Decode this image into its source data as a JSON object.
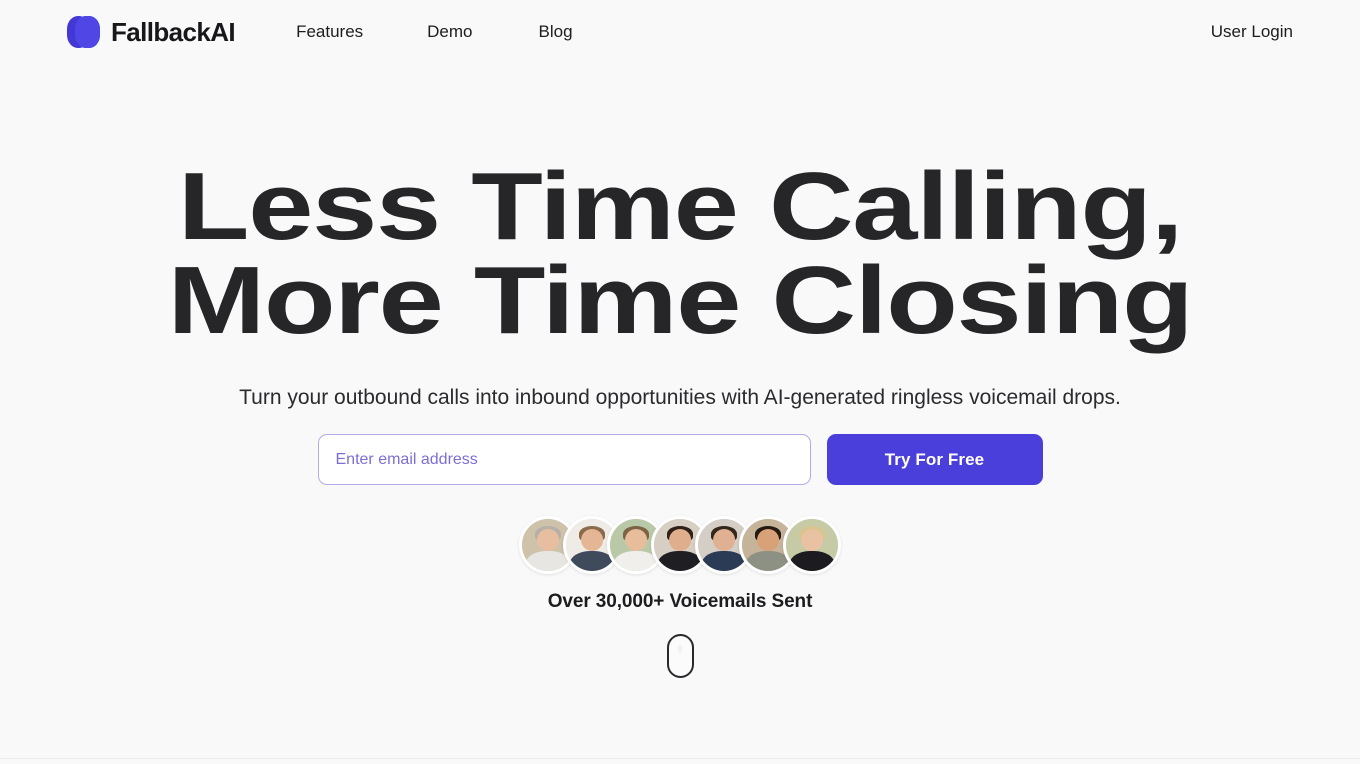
{
  "brand": {
    "name": "FallbackAI",
    "logo_icon": "fallbackai-layered-pill-logo",
    "colors": {
      "primary": "#4f46e5",
      "primary_dark": "#4338d6"
    }
  },
  "header": {
    "nav": [
      {
        "label": "Features",
        "name": "nav-features"
      },
      {
        "label": "Demo",
        "name": "nav-demo"
      },
      {
        "label": "Blog",
        "name": "nav-blog"
      }
    ],
    "login_label": "User Login"
  },
  "hero": {
    "headline_line_1": "Less Time Calling,",
    "headline_line_2": "More Time Closing",
    "subtitle": "Turn your outbound calls into inbound opportunities with AI-generated ringless voicemail drops.",
    "signup": {
      "email_value": "",
      "email_placeholder": "Enter email address",
      "cta_label": "Try For Free",
      "cta_color": "#4b3fdb",
      "input_border_color": "#b3abe8"
    },
    "social_proof": "Over 30,000+ Voicemails Sent",
    "avatars": [
      {
        "name": "avatar-person-1",
        "skin": "#e7bfa0",
        "hair": "#b8b0a6",
        "clothes": "#e8e6e2",
        "bg": "#cfc2ab"
      },
      {
        "name": "avatar-person-2",
        "skin": "#e4b695",
        "hair": "#8a6a4a",
        "clothes": "#3f4a5c",
        "bg": "#efece7"
      },
      {
        "name": "avatar-person-3",
        "skin": "#e8bd9b",
        "hair": "#7e6246",
        "clothes": "#f1efeb",
        "bg": "#b9c9a8"
      },
      {
        "name": "avatar-person-4",
        "skin": "#dfae8c",
        "hair": "#2e2119",
        "clothes": "#1f1e22",
        "bg": "#d8cfc4"
      },
      {
        "name": "avatar-person-5",
        "skin": "#e0b092",
        "hair": "#34271c",
        "clothes": "#2b3a55",
        "bg": "#d4cec6"
      },
      {
        "name": "avatar-person-6",
        "skin": "#d9a177",
        "hair": "#241a12",
        "clothes": "#8d9184",
        "bg": "#c6b49a"
      },
      {
        "name": "avatar-person-7",
        "skin": "#e9c2a3",
        "hair": "#d8c48e",
        "clothes": "#1c1b20",
        "bg": "#c6cba6"
      }
    ],
    "scroll_indicator_icon": "mouse-scroll-icon"
  }
}
